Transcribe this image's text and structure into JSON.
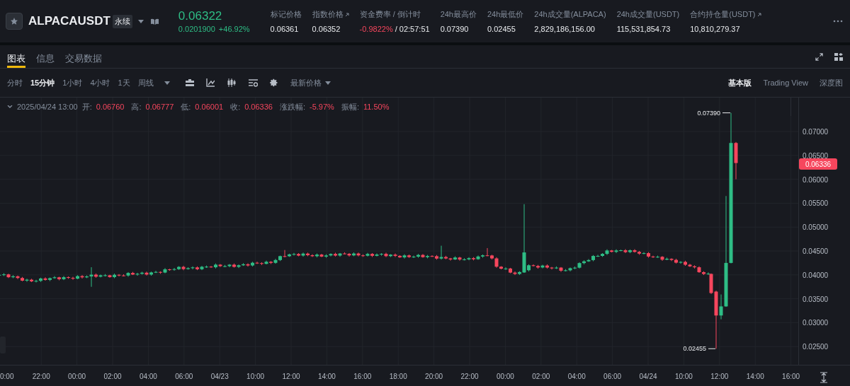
{
  "header": {
    "symbol": "ALPACAUSDT",
    "contract_tag": "永续",
    "last_price": "0.06322",
    "change": "0.0201900",
    "change_pct": "+46.92%",
    "stats": [
      {
        "label": "标记价格",
        "value": "0.06361",
        "external_link": false,
        "kind": "plain"
      },
      {
        "label": "指数价格",
        "value": "0.06352",
        "external_link": true,
        "kind": "plain"
      },
      {
        "label": "资金费率 / 倒计时",
        "value": "-0.9822%",
        "countdown": "/ 02:57:51",
        "external_link": false,
        "kind": "funding"
      },
      {
        "label": "24h最高价",
        "value": "0.07390",
        "external_link": false,
        "kind": "plain"
      },
      {
        "label": "24h最低价",
        "value": "0.02455",
        "external_link": false,
        "kind": "plain"
      },
      {
        "label": "24h成交量(ALPACA)",
        "value": "2,829,186,156.00",
        "external_link": false,
        "kind": "plain"
      },
      {
        "label": "24h成交量(USDT)",
        "value": "115,531,854.73",
        "external_link": false,
        "kind": "plain"
      },
      {
        "label": "合约持仓量(USDT)",
        "value": "10,810,279.37",
        "external_link": true,
        "kind": "plain"
      }
    ]
  },
  "tabs": [
    {
      "label": "图表",
      "selected": true
    },
    {
      "label": "信息",
      "selected": false
    },
    {
      "label": "交易数据",
      "selected": false
    }
  ],
  "intervals": [
    {
      "label": "分时",
      "selected": false
    },
    {
      "label": "15分钟",
      "selected": true
    },
    {
      "label": "1小时",
      "selected": false
    },
    {
      "label": "4小时",
      "selected": false
    },
    {
      "label": "1天",
      "selected": false
    },
    {
      "label": "周线",
      "selected": false
    }
  ],
  "price_type": "最新价格",
  "views": [
    {
      "label": "基本版",
      "selected": true
    },
    {
      "label": "Trading View",
      "selected": false
    },
    {
      "label": "深度图",
      "selected": false
    }
  ],
  "legend": {
    "datetime": "2025/04/24 13:00",
    "fields": [
      {
        "label": "开:",
        "value": "0.06760"
      },
      {
        "label": "高:",
        "value": "0.06777"
      },
      {
        "label": "低:",
        "value": "0.06001"
      },
      {
        "label": "收:",
        "value": "0.06336"
      },
      {
        "label": "涨跌幅:",
        "value": "-5.97%"
      },
      {
        "label": "振幅:",
        "value": "11.50%"
      }
    ]
  },
  "chart": {
    "high_marker": "0.07390",
    "low_marker": "0.02455",
    "current_price": "0.06336",
    "price_ticks": [
      "0.07000",
      "0.06500",
      "0.06000",
      "0.05500",
      "0.05000",
      "0.04500",
      "0.04000",
      "0.03500",
      "0.03000",
      "0.02500"
    ],
    "time_ticks": [
      "0:00",
      "22:00",
      "00:00",
      "02:00",
      "04:00",
      "06:00",
      "04/23",
      "10:00",
      "12:00",
      "14:00",
      "16:00",
      "18:00",
      "20:00",
      "22:00",
      "00:00",
      "02:00",
      "04:00",
      "06:00",
      "04/24",
      "10:00",
      "12:00",
      "14:00",
      "16:00"
    ]
  }
}
